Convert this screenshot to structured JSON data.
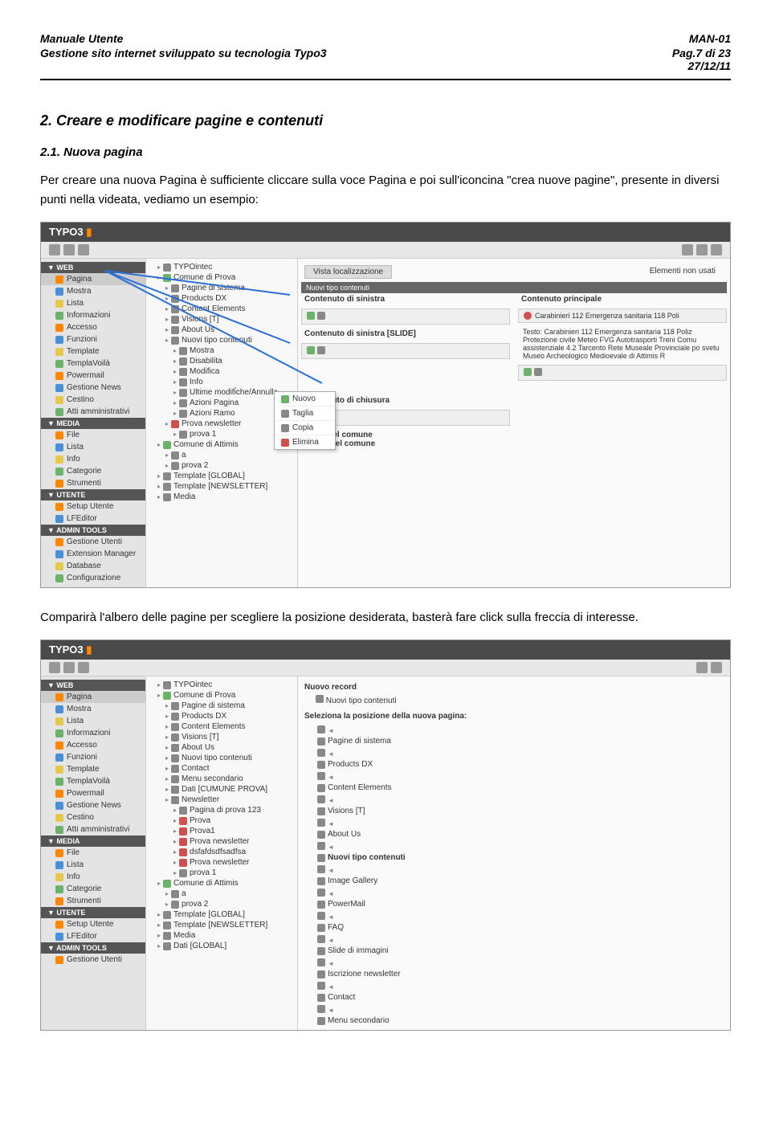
{
  "header": {
    "left_title": "Manuale Utente",
    "right_title": "MAN-01",
    "left_sub": "Gestione sito internet sviluppato su tecnologia Typo3",
    "right_sub_page": "Pag.7 di 23",
    "right_sub_date": "27/12/11"
  },
  "section": {
    "title": "2. Creare e modificare pagine e contenuti",
    "sub": "2.1. Nuova pagina",
    "para1": "Per creare una nuova Pagina è sufficiente cliccare sulla voce Pagina e poi sull'iconcina \"crea nuove pagine\", presente in diversi punti nella videata, vediamo un esempio:",
    "caption2": "Comparirà l'albero delle pagine per scegliere la posizione desiderata, basterà fare click sulla freccia di interesse."
  },
  "figure1": {
    "logo": "TYPO3",
    "top_tabs": {
      "left": "Vista localizzazione",
      "right": "Elementi non usati"
    },
    "col1_groups": [
      {
        "name": "WEB",
        "items": [
          "Pagina",
          "Mostra",
          "Lista",
          "Informazioni",
          "Accesso",
          "Funzioni",
          "Template",
          "TemplaVoilà",
          "Powermail",
          "Gestione News",
          "Cestino",
          "Atti amministrativi"
        ]
      },
      {
        "name": "MEDIA",
        "items": [
          "File",
          "Lista",
          "Info",
          "Categorie",
          "Strumenti"
        ]
      },
      {
        "name": "UTENTE",
        "items": [
          "Setup Utente",
          "LFEditor"
        ]
      },
      {
        "name": "ADMIN TOOLS",
        "items": [
          "Gestione Utenti",
          "Extension Manager",
          "Database",
          "Configurazione"
        ]
      }
    ],
    "tree": [
      {
        "label": "TYPOintec",
        "indent": 0
      },
      {
        "label": "Comune di Prova",
        "indent": 0,
        "icon": "green"
      },
      {
        "label": "Pagine di sistema",
        "indent": 1
      },
      {
        "label": "Products DX",
        "indent": 1
      },
      {
        "label": "Content Elements",
        "indent": 1
      },
      {
        "label": "Visions [T]",
        "indent": 1
      },
      {
        "label": "About Us",
        "indent": 1
      },
      {
        "label": "Nuovi tipo contenuti",
        "indent": 1
      },
      {
        "label": "Mostra",
        "indent": 2
      },
      {
        "label": "Disabilita",
        "indent": 2
      },
      {
        "label": "Modifica",
        "indent": 2
      },
      {
        "label": "Info",
        "indent": 2
      },
      {
        "label": "Ultime modifiche/Annulla",
        "indent": 2
      },
      {
        "label": "Azioni Pagina",
        "indent": 2,
        "arrow": true
      },
      {
        "label": "Azioni Ramo",
        "indent": 2,
        "arrow": true
      },
      {
        "label": "Prova newsletter",
        "indent": 1,
        "icon": "red"
      },
      {
        "label": "prova 1",
        "indent": 2
      },
      {
        "label": "Comune di Attimis",
        "indent": 0,
        "icon": "green"
      },
      {
        "label": "a",
        "indent": 1
      },
      {
        "label": "prova 2",
        "indent": 1
      },
      {
        "label": "Template [GLOBAL]",
        "indent": 0
      },
      {
        "label": "Template [NEWSLETTER]",
        "indent": 0
      },
      {
        "label": "Media",
        "indent": 0
      }
    ],
    "submenu": [
      "Nuovo",
      "Taglia",
      "Copia",
      "Elimina"
    ],
    "content": {
      "strip": "Nuovi tipo contenuti",
      "left_a_title": "Contenuto di sinistra",
      "left_b_title": "Contenuto di sinistra [SLIDE]",
      "close_title": "Contenuto di chiusura",
      "close_lines": [
        "Logo del comune",
        "Nome del comune"
      ],
      "right_title": "Contenuto principale",
      "right_alert": "Carabinieri 112 Emergenza sanitaria 118 Poli",
      "right_text": "Testo: Carabinieri 112 Emergenza sanitaria 118 Poliz Protezione civile Meteo FVG Autotrasporti Treni Comu assistenziale 4.2 Tarcento Rete Museale Provinciale po svetu Museo Archeologico Medioevale di Attimis R"
    }
  },
  "figure2": {
    "col3_title": "Nuovo record",
    "col3_sub": "Nuovi tipo contenuti",
    "col3_prompt": "Seleziona la posizione della nuova pagina:",
    "tree": [
      {
        "label": "TYPOintec",
        "indent": 0
      },
      {
        "label": "Comune di Prova",
        "indent": 0,
        "icon": "green"
      },
      {
        "label": "Pagine di sistema",
        "indent": 1
      },
      {
        "label": "Products DX",
        "indent": 1
      },
      {
        "label": "Content Elements",
        "indent": 1
      },
      {
        "label": "Visions [T]",
        "indent": 1
      },
      {
        "label": "About Us",
        "indent": 1
      },
      {
        "label": "Nuovi tipo contenuti",
        "indent": 1
      },
      {
        "label": "Contact",
        "indent": 1
      },
      {
        "label": "Menu secondario",
        "indent": 1
      },
      {
        "label": "Dati [CUMUNE PROVA]",
        "indent": 1
      },
      {
        "label": "Newsletter",
        "indent": 1
      },
      {
        "label": "Pagina di prova 123",
        "indent": 2
      },
      {
        "label": "Prova",
        "indent": 2,
        "icon": "red"
      },
      {
        "label": "Prova1",
        "indent": 2,
        "icon": "red"
      },
      {
        "label": "Prova newsletter",
        "indent": 2,
        "icon": "red"
      },
      {
        "label": "dsfafdsdfsadfsa",
        "indent": 2,
        "icon": "red"
      },
      {
        "label": "Prova newsletter",
        "indent": 2,
        "icon": "red"
      },
      {
        "label": "prova 1",
        "indent": 2
      },
      {
        "label": "Comune di Attimis",
        "indent": 0,
        "icon": "green"
      },
      {
        "label": "a",
        "indent": 1
      },
      {
        "label": "prova 2",
        "indent": 1
      },
      {
        "label": "Template [GLOBAL]",
        "indent": 0
      },
      {
        "label": "Template [NEWSLETTER]",
        "indent": 0
      },
      {
        "label": "Media",
        "indent": 0
      },
      {
        "label": "Dati [GLOBAL]",
        "indent": 0
      }
    ],
    "select_list": [
      "Pagine di sistema",
      "Products DX",
      "Content Elements",
      "Visions [T]",
      "About Us",
      "Nuovi tipo contenuti",
      "Image Gallery",
      "PowerMail",
      "FAQ",
      "Slide di immagini",
      "Iscrizione newsletter",
      "Contact",
      "Menu secondario"
    ]
  }
}
